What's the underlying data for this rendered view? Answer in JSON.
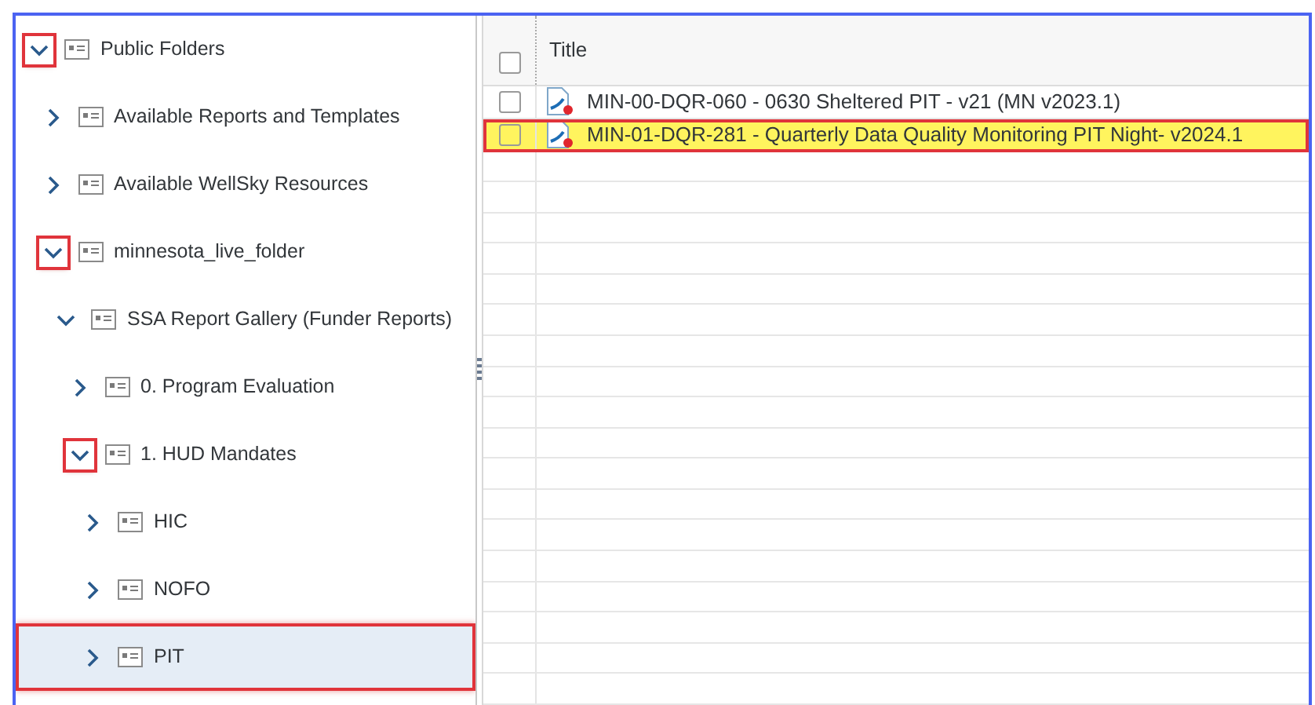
{
  "tree": [
    {
      "label": "Public Folders",
      "expanded": true,
      "selected": false,
      "expander_marked": true,
      "row_marked": false,
      "children": [
        {
          "label": "Available Reports and Templates",
          "expanded": false,
          "selected": false,
          "expander_marked": false,
          "row_marked": false
        },
        {
          "label": "Available WellSky Resources",
          "expanded": false,
          "selected": false,
          "expander_marked": false,
          "row_marked": false
        },
        {
          "label": "minnesota_live_folder",
          "expanded": true,
          "selected": false,
          "expander_marked": true,
          "row_marked": false,
          "children": [
            {
              "label": "SSA Report Gallery (Funder Reports)",
              "expanded": true,
              "selected": false,
              "expander_marked": false,
              "row_marked": false,
              "children": [
                {
                  "label": "0. Program Evaluation",
                  "expanded": false,
                  "selected": false,
                  "expander_marked": false,
                  "row_marked": false
                },
                {
                  "label": "1. HUD Mandates",
                  "expanded": true,
                  "selected": false,
                  "expander_marked": true,
                  "row_marked": false,
                  "children": [
                    {
                      "label": "HIC",
                      "expanded": false,
                      "selected": false,
                      "expander_marked": false,
                      "row_marked": false
                    },
                    {
                      "label": "NOFO",
                      "expanded": false,
                      "selected": false,
                      "expander_marked": false,
                      "row_marked": false
                    },
                    {
                      "label": "PIT",
                      "expanded": false,
                      "selected": true,
                      "expander_marked": false,
                      "row_marked": true
                    }
                  ]
                }
              ]
            }
          ]
        }
      ]
    }
  ],
  "table": {
    "columns": [
      {
        "label": "Title"
      }
    ],
    "header_checked": false,
    "rows": [
      {
        "title": "MIN-00-DQR-060 - 0630 Sheltered PIT - v21 (MN v2023.1)",
        "checked": false,
        "highlighted": false
      },
      {
        "title": "MIN-01-DQR-281 - Quarterly Data Quality Monitoring PIT Night- v2024.1",
        "checked": false,
        "highlighted": true
      }
    ]
  }
}
